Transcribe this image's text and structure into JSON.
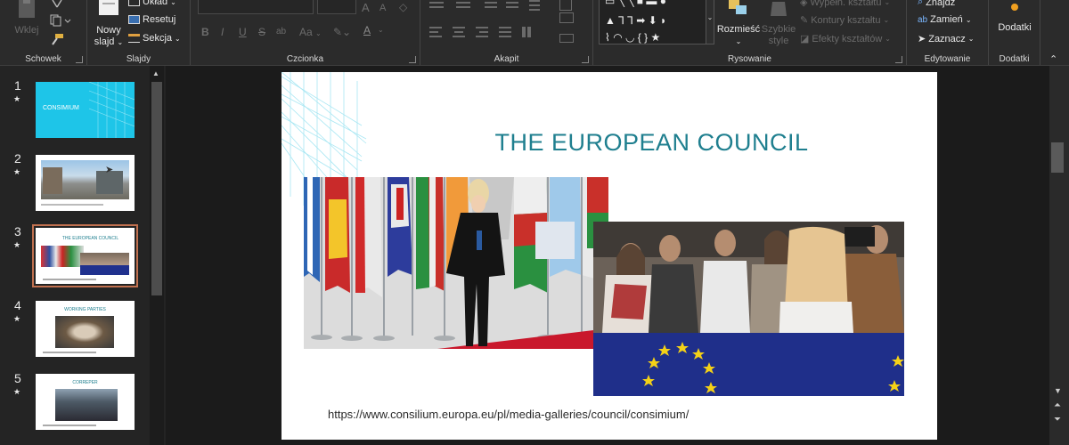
{
  "ribbon": {
    "schowek": {
      "label": "Schowek",
      "paste": "Wklej"
    },
    "slajdy": {
      "label": "Slajdy",
      "new_slide_line1": "Nowy",
      "new_slide_line2": "slajd",
      "layout": "Układ",
      "reset": "Resetuj",
      "section": "Sekcja"
    },
    "czcionka": {
      "label": "Czcionka",
      "font_size_grow": "A",
      "font_size_shrink": "A",
      "bold": "B",
      "italic": "I",
      "underline": "U",
      "strike": "S",
      "spacing": "ab",
      "case": "Aa",
      "color": "A"
    },
    "akapit": {
      "label": "Akapit"
    },
    "rysowanie": {
      "label": "Rysowanie",
      "arrange": "Rozmieść",
      "styles_line1": "Szybkie",
      "styles_line2": "style",
      "fill": "Wypełn. kształtu",
      "outline": "Kontury kształtu",
      "effects": "Efekty kształtów"
    },
    "edytowanie": {
      "label": "Edytowanie",
      "find": "Znajdź",
      "replace": "Zamień",
      "select": "Zaznacz"
    },
    "dodatki": {
      "label": "Dodatki",
      "addins": "Dodatki"
    }
  },
  "thumbnails": [
    {
      "num": "1",
      "star": "★",
      "caption": "CONSIMIUM"
    },
    {
      "num": "2",
      "star": "★"
    },
    {
      "num": "3",
      "star": "★",
      "caption": "THE EUROPEAN COUNCIL"
    },
    {
      "num": "4",
      "star": "★",
      "caption": "WORKING PARTIES"
    },
    {
      "num": "5",
      "star": "★",
      "caption": "CORREPER"
    }
  ],
  "slide": {
    "title": "THE EUROPEAN COUNCIL",
    "url": "https://www.consilium.europa.eu/pl/media-galleries/council/consimium/"
  },
  "colors": {
    "accent_teal": "#1f7f8f",
    "selected_outline": "#c0704f",
    "thumb1_bg": "#1ec5e8"
  }
}
